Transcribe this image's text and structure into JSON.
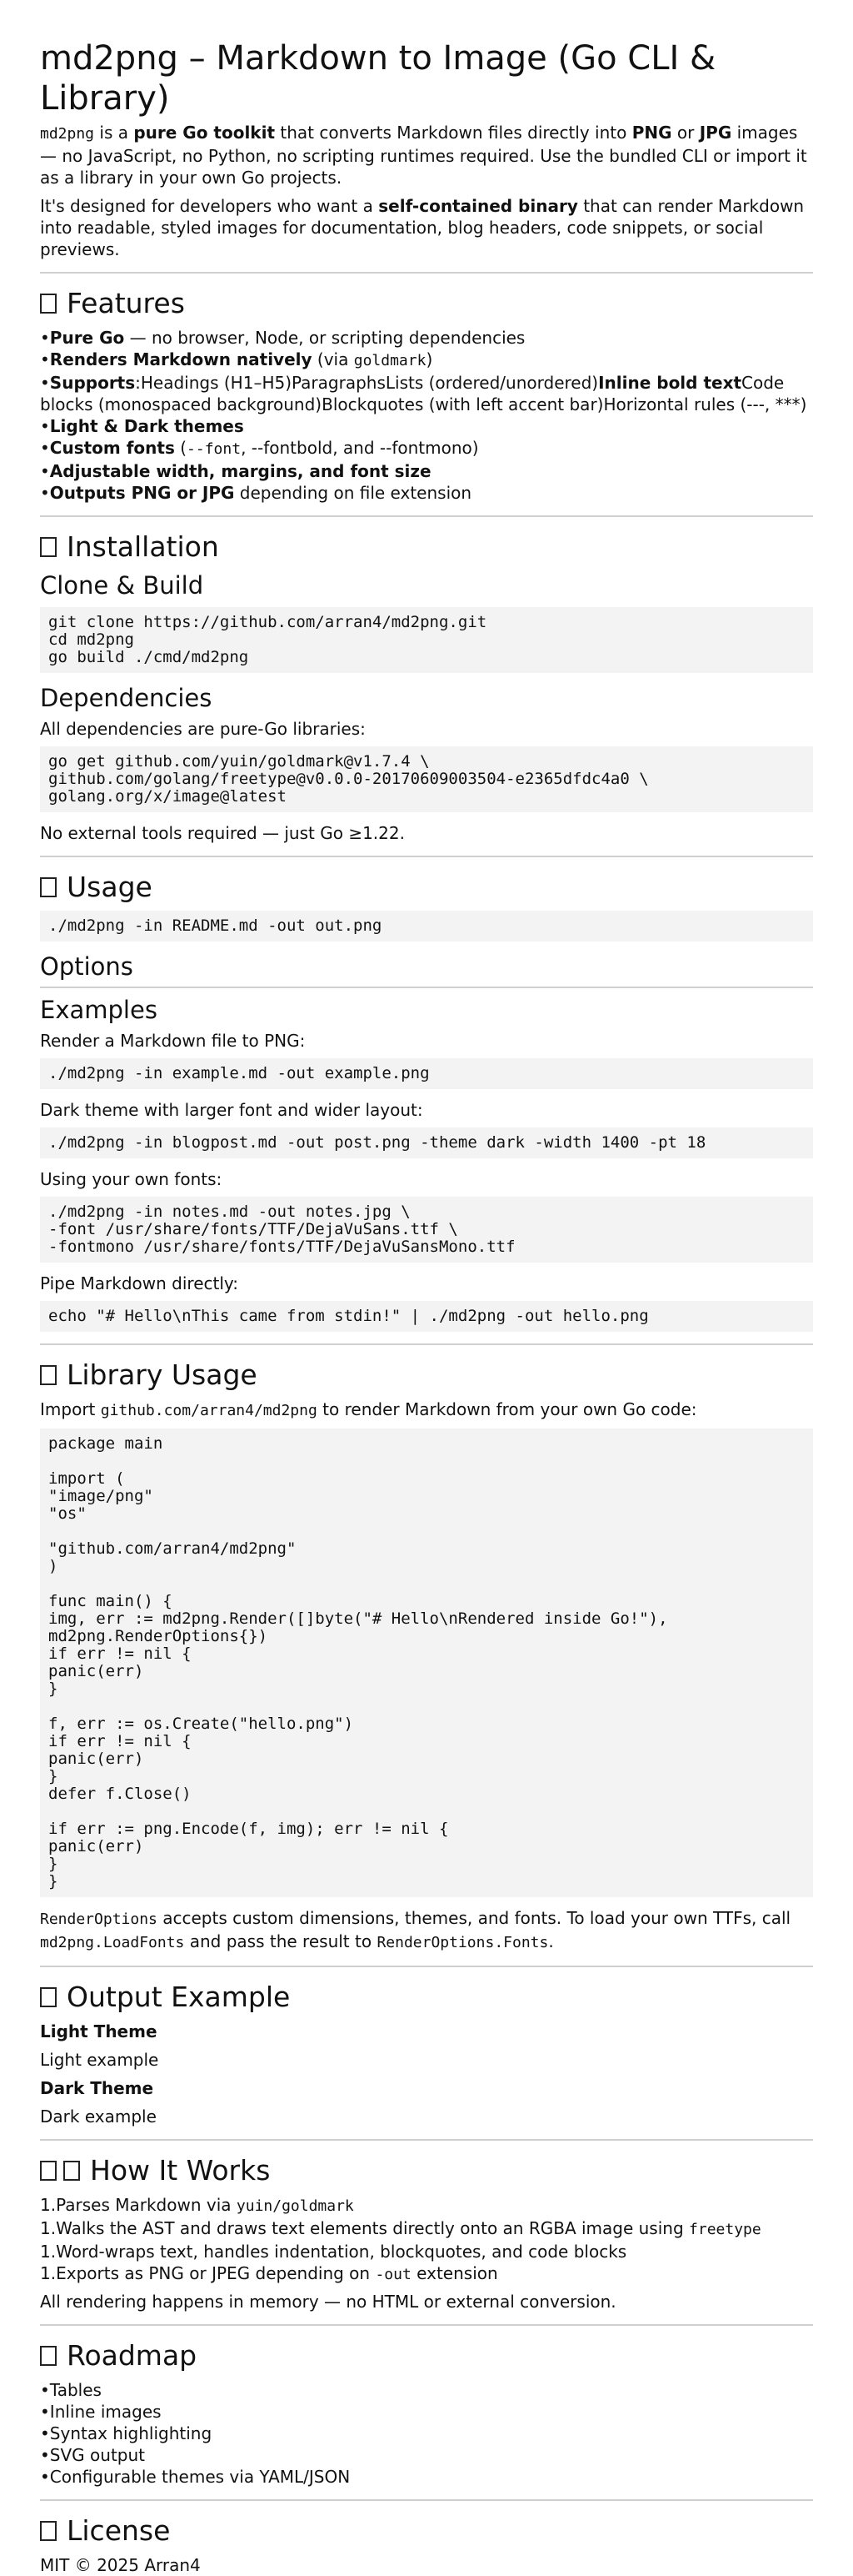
{
  "title": "md2png – Markdown to Image (Go CLI & Library)",
  "intro": {
    "p1_name": "md2png",
    "p1_a": " is a ",
    "p1_b": "pure Go toolkit",
    "p1_c": " that converts Markdown files directly into ",
    "p1_d": "PNG",
    "p1_e": " or ",
    "p1_f": "JPG",
    "p1_g": " images — no JavaScript, no Python, no scripting runtimes required. Use the bundled CLI or import it as a library in your own Go projects.",
    "p2_a": "It's designed for developers who want a ",
    "p2_b": "self-contained binary",
    "p2_c": " that can render Markdown into readable, styled images for documentation, blog headers, code snippets, or social previews."
  },
  "features": {
    "heading": "Features",
    "items": [
      {
        "bold": "Pure Go",
        "rest": " — no browser, Node, or scripting dependencies"
      },
      {
        "bold": "Renders Markdown natively",
        "rest": " (via ",
        "code": "goldmark",
        "tail": ")"
      },
      {
        "bold": "Supports",
        "rest": ":Headings (H1–H5)ParagraphsLists (ordered/unordered)",
        "bold2": "Inline bold text",
        "tail": "Code blocks (monospaced background)Blockquotes (with left accent bar)Horizontal rules (---, ***)"
      },
      {
        "bold": "Light & Dark themes",
        "rest": ""
      },
      {
        "bold": "Custom fonts",
        "rest": " (",
        "code": "--font",
        "tail": ", --fontbold, and --fontmono)"
      },
      {
        "bold": "Adjustable width, margins, and font size",
        "rest": ""
      },
      {
        "bold": "Outputs PNG or JPG",
        "rest": " depending on file extension"
      }
    ]
  },
  "installation": {
    "heading": "Installation",
    "clone_heading": "Clone & Build",
    "clone_code": "git clone https://github.com/arran4/md2png.git\ncd md2png\ngo build ./cmd/md2png",
    "deps_heading": "Dependencies",
    "deps_text": "All dependencies are pure-Go libraries:",
    "deps_code": "go get github.com/yuin/goldmark@v1.7.4 \\\ngithub.com/golang/freetype@v0.0.0-20170609003504-e2365dfdc4a0 \\\ngolang.org/x/image@latest",
    "deps_note": "No external tools required — just Go ≥1.22."
  },
  "usage": {
    "heading": "Usage",
    "code": "./md2png -in README.md -out out.png",
    "options_heading": "Options",
    "examples_heading": "Examples",
    "ex1_text": "Render a Markdown file to PNG:",
    "ex1_code": "./md2png -in example.md -out example.png",
    "ex2_text": "Dark theme with larger font and wider layout:",
    "ex2_code": "./md2png -in blogpost.md -out post.png -theme dark -width 1400 -pt 18",
    "ex3_text": "Using your own fonts:",
    "ex3_code": "./md2png -in notes.md -out notes.jpg \\\n-font /usr/share/fonts/TTF/DejaVuSans.ttf \\\n-fontmono /usr/share/fonts/TTF/DejaVuSansMono.ttf",
    "ex4_text": "Pipe Markdown directly:",
    "ex4_code": "echo \"# Hello\\nThis came from stdin!\" | ./md2png -out hello.png"
  },
  "library": {
    "heading": "Library Usage",
    "intro_a": "Import ",
    "intro_code": "github.com/arran4/md2png",
    "intro_b": " to render Markdown from your own Go code:",
    "code": "package main\n\nimport (\n\"image/png\"\n\"os\"\n\n\"github.com/arran4/md2png\"\n)\n\nfunc main() {\nimg, err := md2png.Render([]byte(\"# Hello\\nRendered inside Go!\"),\nmd2png.RenderOptions{})\nif err != nil {\npanic(err)\n}\n\nf, err := os.Create(\"hello.png\")\nif err != nil {\npanic(err)\n}\ndefer f.Close()\n\nif err := png.Encode(f, img); err != nil {\npanic(err)\n}\n}",
    "note_code1": "RenderOptions",
    "note_a": " accepts custom dimensions, themes, and fonts. To load your own TTFs, call ",
    "note_code2": "md2png.LoadFonts",
    "note_b": " and pass the result to ",
    "note_code3": "RenderOptions.Fonts",
    "note_c": "."
  },
  "output": {
    "heading": "Output Example",
    "light_label": "Light Theme",
    "light_text": "Light example",
    "dark_label": "Dark Theme",
    "dark_text": "Dark example"
  },
  "how": {
    "heading": "How It Works",
    "items": [
      {
        "num": "1.",
        "text": "Parses Markdown via ",
        "code": "yuin/goldmark",
        "tail": ""
      },
      {
        "num": "1.",
        "text": "Walks the AST and draws text elements directly onto an RGBA image using ",
        "code": "freetype",
        "tail": ""
      },
      {
        "num": "1.",
        "text": "Word-wraps text, handles indentation, blockquotes, and code blocks",
        "code": "",
        "tail": ""
      },
      {
        "num": "1.",
        "text": "Exports as PNG or JPEG depending on ",
        "code": "-out",
        "tail": " extension"
      }
    ],
    "note": "All rendering happens in memory — no HTML or external conversion."
  },
  "roadmap": {
    "heading": "Roadmap",
    "items": [
      "Tables",
      "Inline images",
      "Syntax highlighting",
      "SVG output",
      "Configurable themes via YAML/JSON"
    ]
  },
  "license": {
    "heading": "License",
    "text": "MIT © 2025 Arran4"
  }
}
